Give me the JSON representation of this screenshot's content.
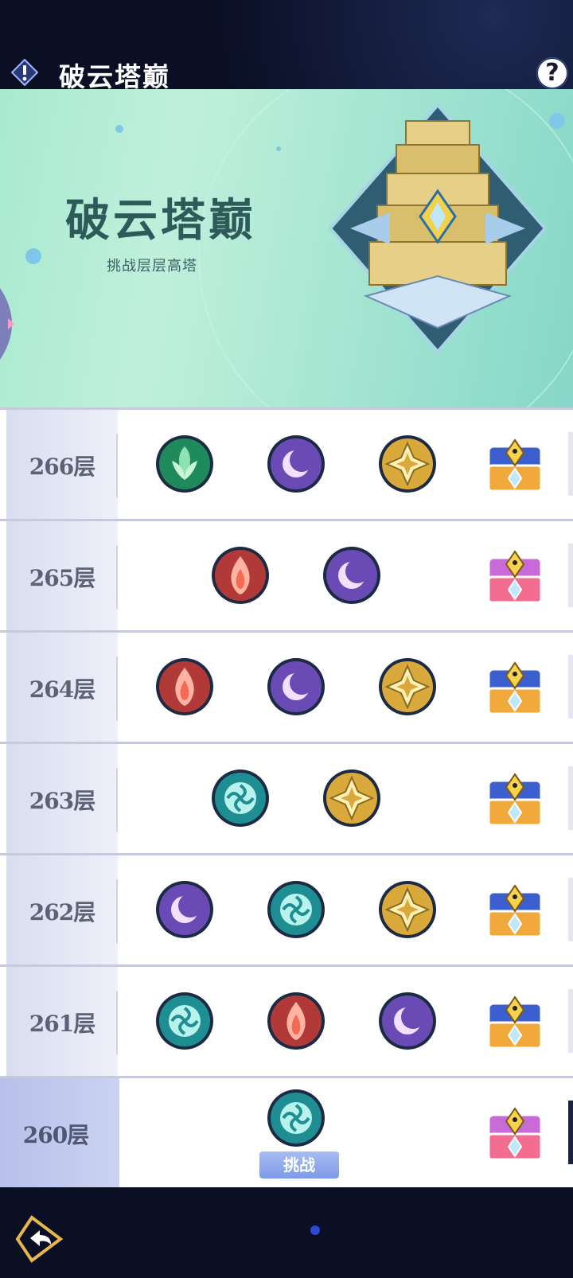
{
  "header": {
    "title": "破云塔巅",
    "help_label": "?"
  },
  "banner": {
    "title": "破云塔巅",
    "subtitle": "挑战层层高塔"
  },
  "floors": [
    {
      "label": "266层",
      "emblems": [
        "leaf-emblem-icon",
        "moon-emblem-icon",
        "star-emblem-icon"
      ],
      "chest": "gold-chest-icon"
    },
    {
      "label": "265层",
      "emblems": [
        "flame-emblem-icon",
        "moon-emblem-icon"
      ],
      "chest": "pink-chest-icon"
    },
    {
      "label": "264层",
      "emblems": [
        "flame-emblem-icon",
        "moon-emblem-icon",
        "star-emblem-icon"
      ],
      "chest": "gold-chest-icon"
    },
    {
      "label": "263层",
      "emblems": [
        "wind-emblem-icon",
        "star-emblem-icon"
      ],
      "chest": "gold-chest-icon"
    },
    {
      "label": "262层",
      "emblems": [
        "moon-emblem-icon",
        "wind-emblem-icon",
        "star-emblem-icon"
      ],
      "chest": "gold-chest-icon"
    },
    {
      "label": "261层",
      "emblems": [
        "wind-emblem-icon",
        "flame-emblem-icon",
        "moon-emblem-icon"
      ],
      "chest": "gold-chest-icon"
    },
    {
      "label": "260层",
      "emblems": [
        "wind-emblem-icon"
      ],
      "chest": "pink-chest-icon",
      "current": true,
      "challenge_label": "挑战"
    }
  ],
  "colors": {
    "leaf": "#1f8a5c",
    "moon": "#6a4bb5",
    "star": "#d9a93b",
    "flame": "#b13a38",
    "wind": "#1f8e93",
    "accent": "#7e9ae6"
  }
}
